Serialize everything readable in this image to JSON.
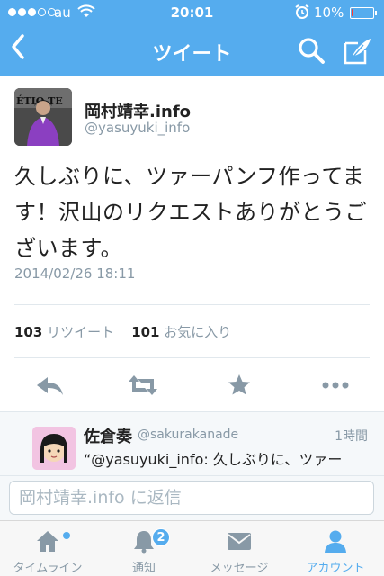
{
  "status_bar": {
    "carrier": "au",
    "time": "20:01",
    "battery_percent": "10%",
    "battery_level": 0.1,
    "battery_color": "#ff3b30"
  },
  "nav": {
    "title": "ツイート",
    "back_icon": "chevron-left-icon",
    "search_icon": "search-icon",
    "compose_icon": "compose-icon"
  },
  "tweet": {
    "author_name": "岡村靖幸.info",
    "author_handle": "@yasuyuki_info",
    "avatar_text": "ÉTIO   TE",
    "text": "久しぶりに、ツァーパンフ作ってます！沢山のリクエストありがとうございます。",
    "date": "2014/02/26 18:11",
    "retweet_count": "103",
    "retweet_label": "リツイート",
    "favorite_count": "101",
    "favorite_label": "お気に入り"
  },
  "actions": [
    {
      "name": "reply-icon"
    },
    {
      "name": "retweet-icon"
    },
    {
      "name": "favorite-star-icon"
    },
    {
      "name": "more-icon"
    }
  ],
  "reply": {
    "name": "佐倉奏",
    "handle": "@sakurakanade",
    "time": "1時間",
    "text": "“@yasuyuki_info: 久しぶりに、ツァー"
  },
  "composer": {
    "placeholder": "岡村靖幸.info に返信"
  },
  "tabbar": {
    "tabs": [
      {
        "label": "タイムライン",
        "icon": "home-icon",
        "has_dot": true
      },
      {
        "label": "通知",
        "icon": "bell-icon",
        "badge": "2"
      },
      {
        "label": "メッセージ",
        "icon": "envelope-icon"
      },
      {
        "label": "アカウント",
        "icon": "person-icon",
        "active": true
      }
    ]
  },
  "colors": {
    "brand": "#55acee",
    "text": "#222222",
    "muted": "#8899a6"
  }
}
